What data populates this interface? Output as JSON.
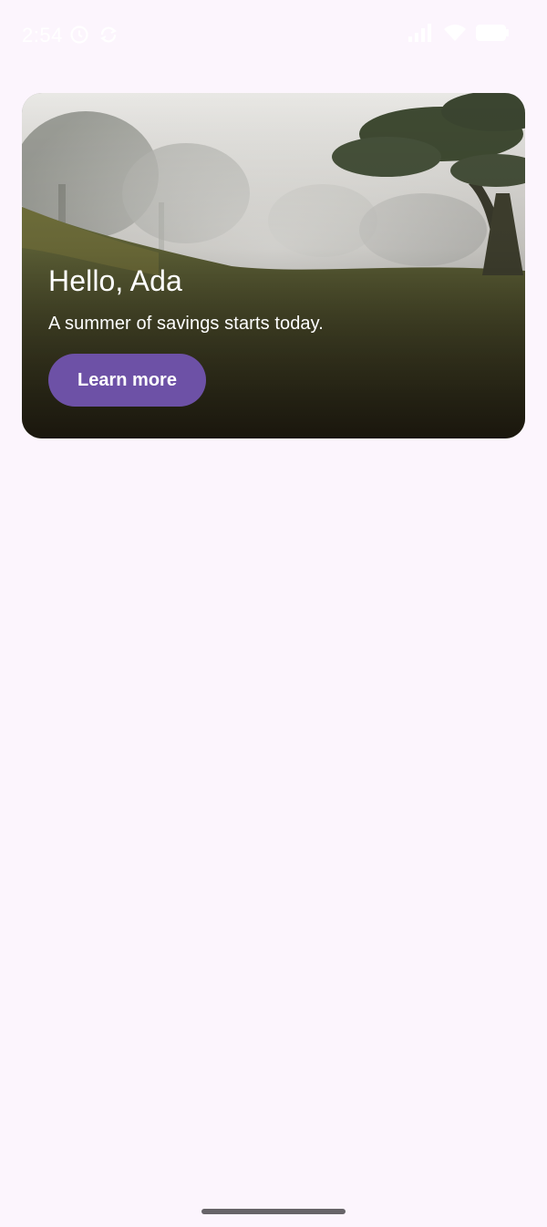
{
  "status_bar": {
    "time": "2:54",
    "left_icons": [
      "alarm-icon",
      "sync-icon"
    ],
    "right_icons": [
      "signal-icon",
      "wifi-icon",
      "battery-icon"
    ]
  },
  "hero_card": {
    "image": "misty-forest-hillside-photo",
    "title": "Hello, Ada",
    "subtitle": "A summer of savings starts today.",
    "button_label": "Learn more",
    "button_color": "#6d51a6"
  },
  "colors": {
    "background": "#fcf5fd",
    "on_image_text": "#ffffff",
    "gesture_bar": "#676468"
  },
  "navigation": {
    "gesture_bar": "gesture-handle"
  }
}
